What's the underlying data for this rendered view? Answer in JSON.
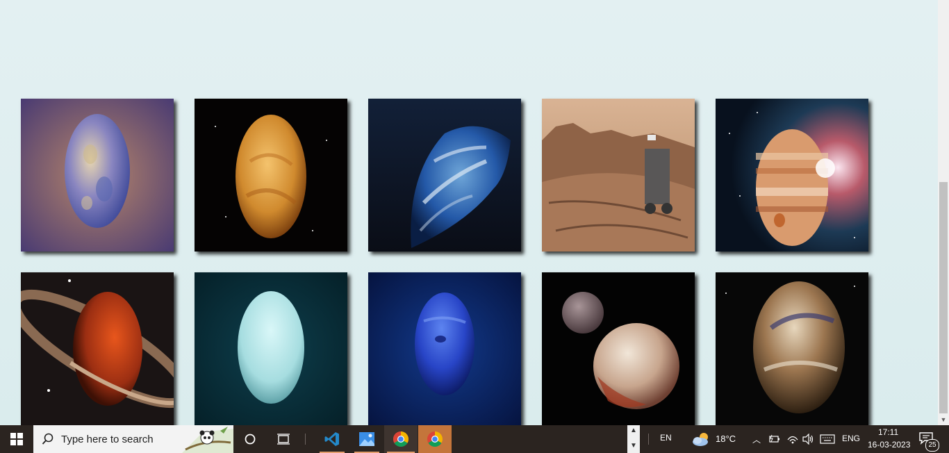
{
  "gallery": {
    "tiles": [
      {
        "icon": "mercury-image"
      },
      {
        "icon": "venus-image"
      },
      {
        "icon": "earth-image"
      },
      {
        "icon": "mars-image"
      },
      {
        "icon": "jupiter-image"
      },
      {
        "icon": "saturn-image"
      },
      {
        "icon": "uranus-image"
      },
      {
        "icon": "neptune-image"
      },
      {
        "icon": "pluto-image"
      },
      {
        "icon": "exoplanet-image"
      }
    ]
  },
  "taskbar": {
    "search_placeholder": "Type here to search",
    "pinned": [
      "vscode-icon",
      "photos-icon",
      "chrome-icon",
      "chrome-icon"
    ],
    "language_short": "EN",
    "weather": "18°C",
    "input_lang": "ENG",
    "time": "17:11",
    "date": "16-03-2023",
    "notification_count": "25",
    "colors": {
      "bar": "#2b2420",
      "accent": "#c4753b"
    }
  }
}
